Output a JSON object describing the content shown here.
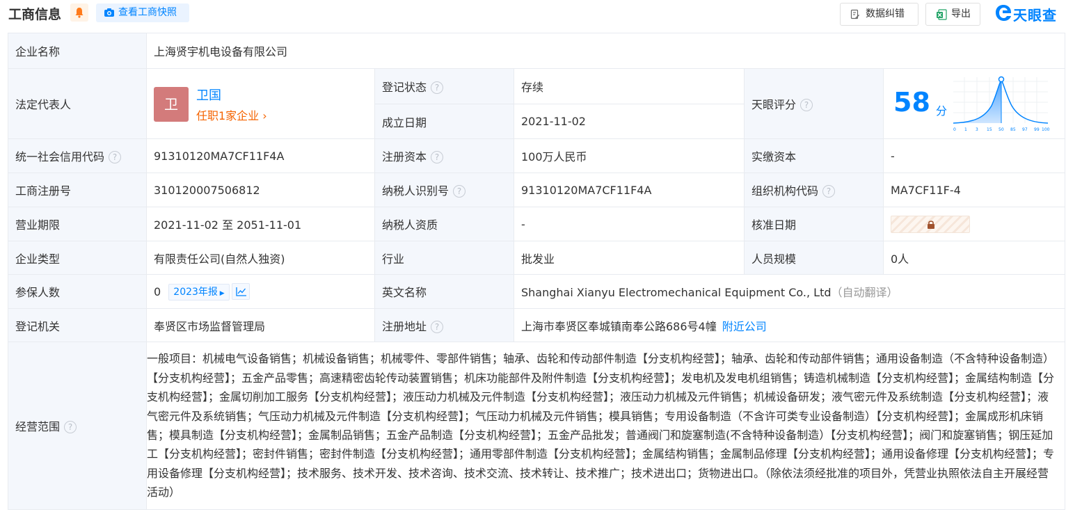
{
  "header": {
    "title": "工商信息",
    "snapshot_label": "查看工商快照",
    "fix_label": "数据纠错",
    "export_label": "导出",
    "logo_text": "天眼查",
    "accent": "#0084ff"
  },
  "company": {
    "name_label": "企业名称",
    "name": "上海贤宇机电设备有限公司",
    "rep_label": "法定代表人",
    "rep_avatar": "卫",
    "rep_name": "卫国",
    "rep_positions": "任职1家企业",
    "reg_status_label": "登记状态",
    "reg_status": "存续",
    "established_label": "成立日期",
    "established": "2021-11-02",
    "score_label": "天眼评分",
    "score": "58",
    "score_unit": "分",
    "score_axis": [
      "0",
      "1",
      "3",
      "15",
      "50",
      "85",
      "97",
      "99",
      "100"
    ],
    "credit_code_label": "统一社会信用代码",
    "credit_code": "91310120MA7CF11F4A",
    "reg_capital_label": "注册资本",
    "reg_capital": "100万人民币",
    "paid_capital_label": "实缴资本",
    "paid_capital": "-",
    "biz_reg_no_label": "工商注册号",
    "biz_reg_no": "310120007506812",
    "taxpayer_id_label": "纳税人识别号",
    "taxpayer_id": "91310120MA7CF11F4A",
    "org_code_label": "组织机构代码",
    "org_code": "MA7CF11F-4",
    "term_label": "营业期限",
    "term": "2021-11-02 至 2051-11-01",
    "taxpayer_qual_label": "纳税人资质",
    "taxpayer_qual": "-",
    "approval_date_label": "核准日期",
    "type_label": "企业类型",
    "type": "有限责任公司(自然人独资)",
    "industry_label": "行业",
    "industry": "批发业",
    "staff_size_label": "人员规模",
    "staff_size": "0人",
    "insured_label": "参保人数",
    "insured": "0",
    "insured_year": "2023年报",
    "english_name_label": "英文名称",
    "english_name": "Shanghai Xianyu Electromechanical Equipment Co., Ltd",
    "auto_translate": "（自动翻译）",
    "authority_label": "登记机关",
    "authority": "奉贤区市场监督管理局",
    "address_label": "注册地址",
    "address": "上海市奉贤区奉城镇南奉公路686号4幢",
    "nearby_label": "附近公司",
    "scope_label": "经营范围",
    "scope": "一般项目：机械电气设备销售；机械设备销售；机械零件、零部件销售；轴承、齿轮和传动部件制造【分支机构经营】；轴承、齿轮和传动部件销售；通用设备制造（不含特种设备制造）【分支机构经营】；五金产品零售；高速精密齿轮传动装置销售；机床功能部件及附件制造【分支机构经营】；发电机及发电机组销售；铸造机械制造【分支机构经营】；金属结构制造【分支机构经营】；金属切削加工服务【分支机构经营】；液压动力机械及元件制造【分支机构经营】；液压动力机械及元件销售；机械设备研发；液气密元件及系统制造【分支机构经营】；液气密元件及系统销售；气压动力机械及元件制造【分支机构经营】；气压动力机械及元件销售；模具销售；专用设备制造（不含许可类专业设备制造）【分支机构经营】；金属成形机床销售；模具制造【分支机构经营】；金属制品销售；五金产品制造【分支机构经营】；五金产品批发；普通阀门和旋塞制造(不含特种设备制造）【分支机构经营】；阀门和旋塞销售；钢压延加工【分支机构经营】；密封件销售；密封件制造【分支机构经营】；通用零部件制造【分支机构经营】；金属结构销售；金属制品修理【分支机构经营】；通用设备修理【分支机构经营】；专用设备修理【分支机构经营】；技术服务、技术开发、技术咨询、技术交流、技术转让、技术推广；技术进出口；货物进出口。（除依法须经批准的项目外，凭营业执照依法自主开展经营活动）"
  }
}
